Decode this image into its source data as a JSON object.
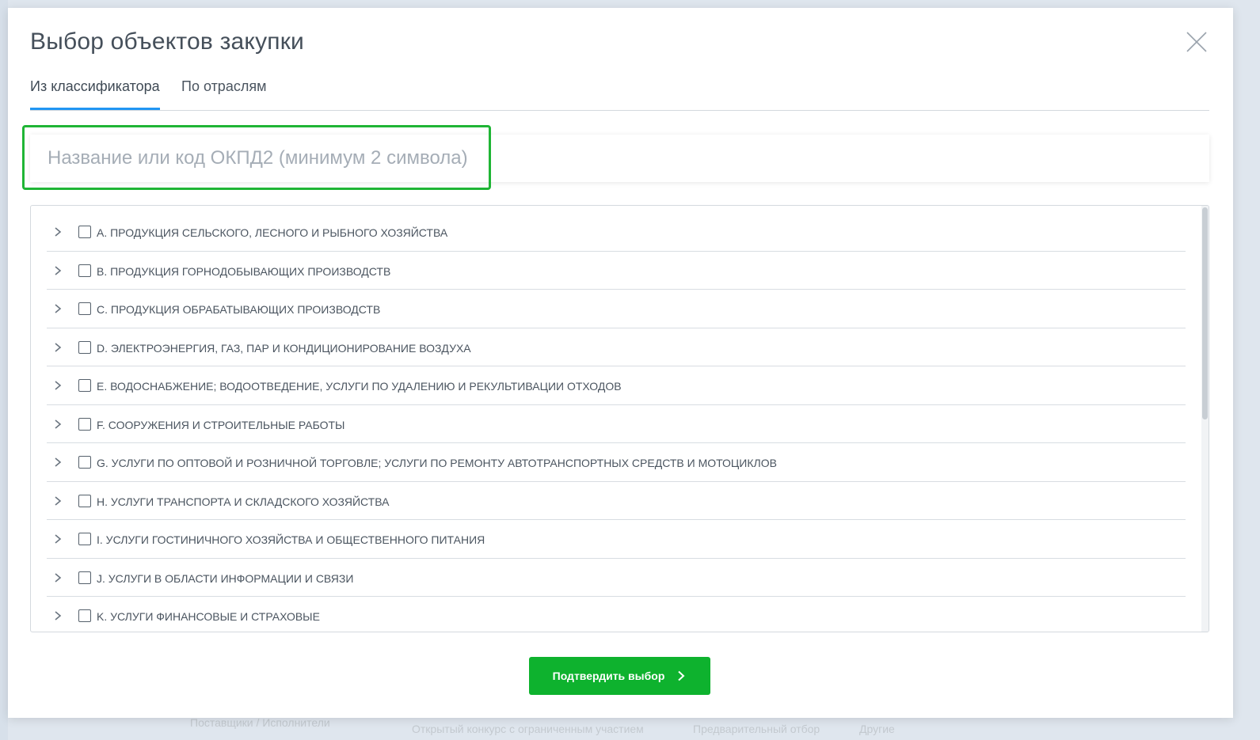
{
  "backdrop": {
    "text_1": "Поставщики / Исполнители",
    "text_2": "Открытый конкурс с ограниченным участием",
    "text_3": "Предварительный отбор",
    "text_4": "Другие"
  },
  "modal": {
    "title": "Выбор объектов закупки",
    "close_icon": "close-icon"
  },
  "tabs": [
    {
      "label": "Из классификатора",
      "active": true
    },
    {
      "label": "По отраслям",
      "active": false
    }
  ],
  "search": {
    "placeholder": "Название или код ОКПД2 (минимум 2 символа)",
    "value": ""
  },
  "tree": {
    "items": [
      {
        "label": "A. ПРОДУКЦИЯ СЕЛЬСКОГО, ЛЕСНОГО И РЫБНОГО ХОЗЯЙСТВА",
        "checked": false
      },
      {
        "label": "B. ПРОДУКЦИЯ ГОРНОДОБЫВАЮЩИХ ПРОИЗВОДСТВ",
        "checked": false
      },
      {
        "label": "C. ПРОДУКЦИЯ ОБРАБАТЫВАЮЩИХ ПРОИЗВОДСТВ",
        "checked": false
      },
      {
        "label": "D. ЭЛЕКТРОЭНЕРГИЯ, ГАЗ, ПАР И КОНДИЦИОНИРОВАНИЕ ВОЗДУХА",
        "checked": false
      },
      {
        "label": "E. ВОДОСНАБЖЕНИЕ; ВОДООТВЕДЕНИЕ, УСЛУГИ ПО УДАЛЕНИЮ И РЕКУЛЬТИВАЦИИ ОТХОДОВ",
        "checked": false
      },
      {
        "label": "F. СООРУЖЕНИЯ И СТРОИТЕЛЬНЫЕ РАБОТЫ",
        "checked": false
      },
      {
        "label": "G. УСЛУГИ ПО ОПТОВОЙ И РОЗНИЧНОЙ ТОРГОВЛЕ; УСЛУГИ ПО РЕМОНТУ АВТОТРАНСПОРТНЫХ СРЕДСТВ И МОТОЦИКЛОВ",
        "checked": false
      },
      {
        "label": "H. УСЛУГИ ТРАНСПОРТА И СКЛАДСКОГО ХОЗЯЙСТВА",
        "checked": false
      },
      {
        "label": "I. УСЛУГИ ГОСТИНИЧНОГО ХОЗЯЙСТВА И ОБЩЕСТВЕННОГО ПИТАНИЯ",
        "checked": false
      },
      {
        "label": "J. УСЛУГИ В ОБЛАСТИ ИНФОРМАЦИИ И СВЯЗИ",
        "checked": false
      },
      {
        "label": "K. УСЛУГИ ФИНАНСОВЫЕ И СТРАХОВЫЕ",
        "checked": false
      }
    ]
  },
  "footer": {
    "confirm_label": "Подтвердить выбор"
  },
  "colors": {
    "accent_tab": "#2196f3",
    "confirm_button": "#0eb22e",
    "search_highlight": "#1fb535"
  }
}
